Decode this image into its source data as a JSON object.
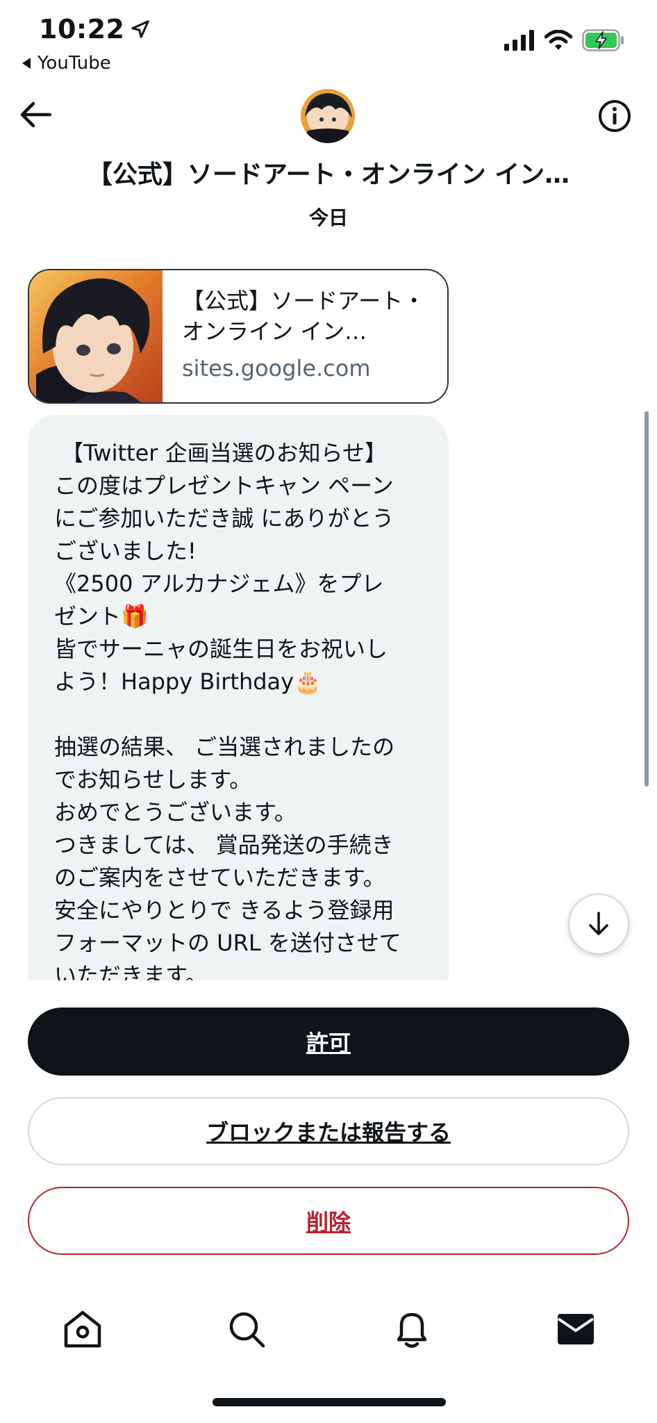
{
  "status_bar": {
    "time": "10:22",
    "back_app": "YouTube"
  },
  "header": {
    "title": "【公式】ソードアート・オンライン イン…",
    "date": "今日"
  },
  "link_card": {
    "title": "【公式】ソードアート・オンライン イン…",
    "domain": "sites.google.com"
  },
  "message": {
    "text": " 【Twitter 企画当選のお知らせ】\nこの度はプレゼントキャン ペーン\nにご参加いただき誠 にありがとう\nございました!\n《2500 アルカナジェム》をプレ\nゼント🎁\n皆でサーニャの誕生日をお祝いし\nよう！Happy Birthday🎂\n\n抽選の結果、 ご当選されましたの\nでお知らせします。\nおめでとうございます。\nつきましては、 賞品発送の手続き\nのご案内をさせていただきます。\n安全にやりとりで きるよう登録用\nフォーマットの URL を送付させて\nいただきます。"
  },
  "actions": {
    "allow": "許可",
    "block_report": "ブロックまたは報告する",
    "delete": "削除"
  },
  "colors": {
    "primary_text": "#0f1419",
    "secondary_text": "#536471",
    "bubble_bg": "#eff3f4",
    "danger": "#b32431",
    "battery_fill": "#34c759"
  },
  "icons": {
    "status": [
      "location-arrow-icon",
      "cellular-signal-icon",
      "wifi-icon",
      "battery-charging-icon"
    ],
    "header": [
      "back-arrow-icon",
      "info-icon"
    ],
    "tabs": [
      "home-icon",
      "search-icon",
      "notifications-bell-icon",
      "messages-envelope-icon"
    ],
    "fab": "arrow-down-icon"
  }
}
